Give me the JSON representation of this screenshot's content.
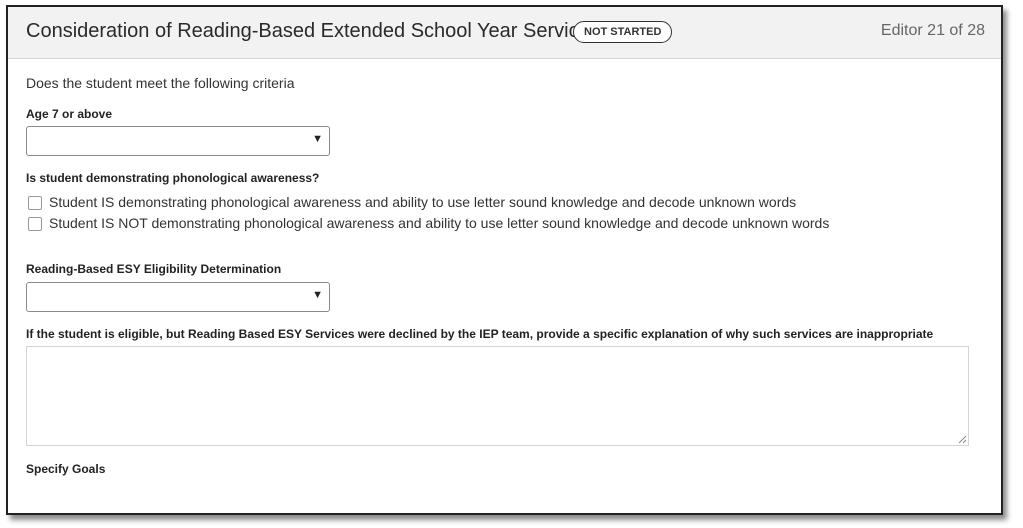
{
  "header": {
    "title": "Consideration of Reading-Based Extended School Year Services",
    "status_badge": "NOT STARTED",
    "editor_count": "Editor 21 of 28"
  },
  "form": {
    "intro": "Does the student meet the following criteria",
    "age_label": "Age 7 or above",
    "age_value": "",
    "phonological_label": "Is student demonstrating phonological awareness?",
    "phonological_options": [
      "Student IS demonstrating phonological awareness and ability to use letter sound knowledge and decode unknown words",
      "Student IS NOT demonstrating phonological awareness and ability to use letter sound knowledge and decode unknown words"
    ],
    "eligibility_label": "Reading-Based ESY Eligibility Determination",
    "eligibility_value": "",
    "explanation_label": "If the student is eligible, but Reading Based ESY Services were declined by the IEP team, provide a specific explanation of why such services are inappropriate",
    "explanation_value": "",
    "goals_label": "Specify Goals"
  },
  "icons": {
    "dropdown": "chevron-down-icon",
    "resize": "resize-handle-icon"
  }
}
